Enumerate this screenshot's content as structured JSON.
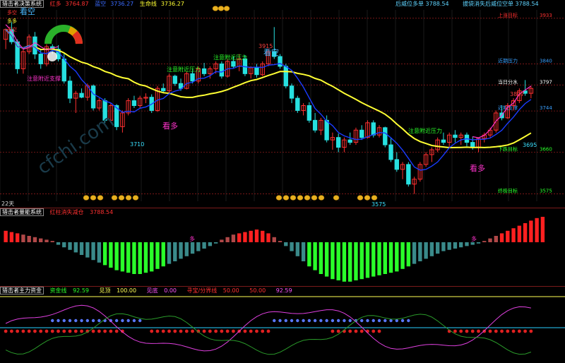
{
  "panel1": {
    "system": "猎击者决策系统",
    "hong_duo_label": "红多",
    "hong_duo_value": "3764.87",
    "lan_kong_label": "蓝空",
    "lan_kong_value": "3736.27",
    "life_label": "生命线",
    "life_value": "3736.27",
    "top_right_1": "后威位多单 3788.54",
    "top_right_2": "拔袋消失后威位空单 3788.54",
    "kan_kong": "看空",
    "kan_duo": "看多",
    "notes": [
      "注意附近压力",
      "注意附近压力",
      "注意附近压力",
      "注意附近支撑"
    ],
    "small_legend": [
      "多空",
      "多多",
      "多空"
    ],
    "days": "22天",
    "levels": [
      {
        "name": "上涨目标",
        "value": "3933",
        "color": "#ff3030"
      },
      {
        "name": "近期压力",
        "value": "3840",
        "color": "#3aa0ff"
      },
      {
        "name": "当日分水",
        "value": "3797",
        "color": "#ffffff"
      },
      {
        "name": "近期支撑",
        "value": "3744",
        "color": "#3aa0ff"
      },
      {
        "name": "下跌目标",
        "value": "3660",
        "color": "#2aff2a"
      },
      {
        "name": "终极目标",
        "value": "3575",
        "color": "#2aff2a"
      }
    ],
    "price_labels": {
      "peak": "3915",
      "low1": "3710",
      "low2": "3575",
      "right_high": "3807",
      "right_mid": "3695"
    }
  },
  "panel2": {
    "system": "猎击者量能系统",
    "legend": "红柱消失减仓",
    "value": "3788.54",
    "marker": "多"
  },
  "panel3": {
    "system": "猎击者主力资金",
    "items": [
      {
        "label": "资金线",
        "value": "92.59",
        "color": "#2aff2a"
      },
      {
        "label": "见顶",
        "value": "100.00",
        "color": "#ffff55"
      },
      {
        "label": "见底",
        "value": "0.00",
        "color": "#ff55ff"
      },
      {
        "label": "寻宝/分界线",
        "value": "50.00",
        "color": "#ff3030"
      },
      {
        "label": "",
        "value": "50.00",
        "color": "#ff3030"
      },
      {
        "label": "",
        "value": "92.59",
        "color": "#ff55ff"
      }
    ]
  },
  "watermark": "cfchi.com",
  "colors": {
    "up": "#ff3030",
    "down": "#27e0e0",
    "ma_yellow": "#ffff33",
    "ma_blue": "#1a3cff",
    "ma_magenta": "#ff33cc"
  },
  "chart_data": {
    "type": "candlestick",
    "y_range": [
      3560,
      3950
    ],
    "candles": [
      [
        3890,
        3912,
        3870,
        3910
      ],
      [
        3910,
        3925,
        3880,
        3885
      ],
      [
        3885,
        3890,
        3820,
        3830
      ],
      [
        3830,
        3870,
        3820,
        3865
      ],
      [
        3865,
        3900,
        3860,
        3895
      ],
      [
        3895,
        3905,
        3850,
        3860
      ],
      [
        3860,
        3870,
        3830,
        3840
      ],
      [
        3840,
        3880,
        3835,
        3875
      ],
      [
        3875,
        3880,
        3860,
        3870
      ],
      [
        3870,
        3878,
        3845,
        3850
      ],
      [
        3850,
        3860,
        3800,
        3805
      ],
      [
        3805,
        3815,
        3760,
        3770
      ],
      [
        3770,
        3785,
        3740,
        3780
      ],
      [
        3780,
        3790,
        3770,
        3772
      ],
      [
        3772,
        3800,
        3765,
        3795
      ],
      [
        3795,
        3798,
        3745,
        3750
      ],
      [
        3750,
        3770,
        3745,
        3765
      ],
      [
        3765,
        3770,
        3720,
        3725
      ],
      [
        3725,
        3760,
        3720,
        3755
      ],
      [
        3755,
        3758,
        3705,
        3712
      ],
      [
        3712,
        3745,
        3700,
        3740
      ],
      [
        3740,
        3770,
        3735,
        3765
      ],
      [
        3765,
        3775,
        3750,
        3755
      ],
      [
        3755,
        3775,
        3750,
        3770
      ],
      [
        3770,
        3780,
        3760,
        3772
      ],
      [
        3772,
        3778,
        3740,
        3745
      ],
      [
        3745,
        3795,
        3742,
        3790
      ],
      [
        3790,
        3800,
        3780,
        3785
      ],
      [
        3785,
        3820,
        3780,
        3815
      ],
      [
        3815,
        3818,
        3795,
        3800
      ],
      [
        3800,
        3810,
        3785,
        3790
      ],
      [
        3790,
        3825,
        3788,
        3820
      ],
      [
        3820,
        3830,
        3800,
        3805
      ],
      [
        3805,
        3835,
        3800,
        3830
      ],
      [
        3830,
        3842,
        3815,
        3820
      ],
      [
        3820,
        3835,
        3810,
        3830
      ],
      [
        3830,
        3845,
        3820,
        3840
      ],
      [
        3840,
        3845,
        3810,
        3815
      ],
      [
        3815,
        3850,
        3812,
        3845
      ],
      [
        3845,
        3855,
        3830,
        3835
      ],
      [
        3835,
        3860,
        3825,
        3850
      ],
      [
        3850,
        3858,
        3815,
        3820
      ],
      [
        3820,
        3835,
        3810,
        3832
      ],
      [
        3832,
        3840,
        3812,
        3818
      ],
      [
        3818,
        3845,
        3815,
        3840
      ],
      [
        3840,
        3870,
        3835,
        3865
      ],
      [
        3865,
        3915,
        3850,
        3855
      ],
      [
        3855,
        3860,
        3830,
        3835
      ],
      [
        3835,
        3840,
        3790,
        3795
      ],
      [
        3795,
        3800,
        3760,
        3770
      ],
      [
        3770,
        3775,
        3740,
        3745
      ],
      [
        3745,
        3760,
        3735,
        3755
      ],
      [
        3755,
        3762,
        3720,
        3725
      ],
      [
        3725,
        3740,
        3700,
        3705
      ],
      [
        3705,
        3730,
        3695,
        3725
      ],
      [
        3725,
        3735,
        3680,
        3685
      ],
      [
        3685,
        3700,
        3665,
        3690
      ],
      [
        3690,
        3698,
        3660,
        3670
      ],
      [
        3670,
        3690,
        3660,
        3685
      ],
      [
        3685,
        3700,
        3675,
        3680
      ],
      [
        3680,
        3710,
        3675,
        3705
      ],
      [
        3705,
        3715,
        3685,
        3690
      ],
      [
        3690,
        3725,
        3688,
        3720
      ],
      [
        3720,
        3725,
        3690,
        3695
      ],
      [
        3695,
        3715,
        3690,
        3710
      ],
      [
        3710,
        3712,
        3670,
        3675
      ],
      [
        3675,
        3690,
        3640,
        3645
      ],
      [
        3645,
        3660,
        3620,
        3625
      ],
      [
        3625,
        3640,
        3605,
        3635
      ],
      [
        3635,
        3640,
        3590,
        3595
      ],
      [
        3595,
        3610,
        3575,
        3605
      ],
      [
        3605,
        3640,
        3600,
        3635
      ],
      [
        3635,
        3660,
        3630,
        3655
      ],
      [
        3655,
        3670,
        3640,
        3665
      ],
      [
        3665,
        3690,
        3660,
        3685
      ],
      [
        3685,
        3700,
        3675,
        3680
      ],
      [
        3680,
        3700,
        3670,
        3695
      ],
      [
        3695,
        3705,
        3680,
        3690
      ],
      [
        3690,
        3700,
        3675,
        3695
      ],
      [
        3695,
        3700,
        3672,
        3680
      ],
      [
        3680,
        3692,
        3665,
        3670
      ],
      [
        3670,
        3690,
        3660,
        3688
      ],
      [
        3688,
        3700,
        3680,
        3695
      ],
      [
        3695,
        3710,
        3690,
        3705
      ],
      [
        3705,
        3745,
        3700,
        3740
      ],
      [
        3740,
        3755,
        3725,
        3730
      ],
      [
        3730,
        3760,
        3728,
        3755
      ],
      [
        3755,
        3770,
        3745,
        3765
      ],
      [
        3765,
        3790,
        3760,
        3785
      ],
      [
        3785,
        3807,
        3775,
        3780
      ],
      [
        3780,
        3795,
        3770,
        3790
      ]
    ],
    "volume": [
      18,
      16,
      14,
      12,
      10,
      8,
      6,
      4,
      2,
      -4,
      -8,
      -12,
      -16,
      -20,
      -24,
      -28,
      -32,
      -36,
      -40,
      -44,
      -46,
      -48,
      -50,
      -50,
      -48,
      -46,
      -42,
      -38,
      -34,
      -30,
      -26,
      -22,
      -18,
      -14,
      -10,
      -6,
      -2,
      4,
      8,
      12,
      14,
      16,
      18,
      20,
      18,
      14,
      8,
      2,
      -6,
      -14,
      -22,
      -30,
      -38,
      -44,
      -50,
      -54,
      -58,
      -60,
      -62,
      -62,
      -60,
      -58,
      -56,
      -54,
      -52,
      -50,
      -48,
      -46,
      -42,
      -38,
      -34,
      -30,
      -26,
      -22,
      -18,
      -14,
      -12,
      -10,
      -8,
      -6,
      -4,
      -2,
      2,
      6,
      10,
      14,
      18,
      22,
      26,
      30,
      34,
      38,
      40
    ]
  }
}
